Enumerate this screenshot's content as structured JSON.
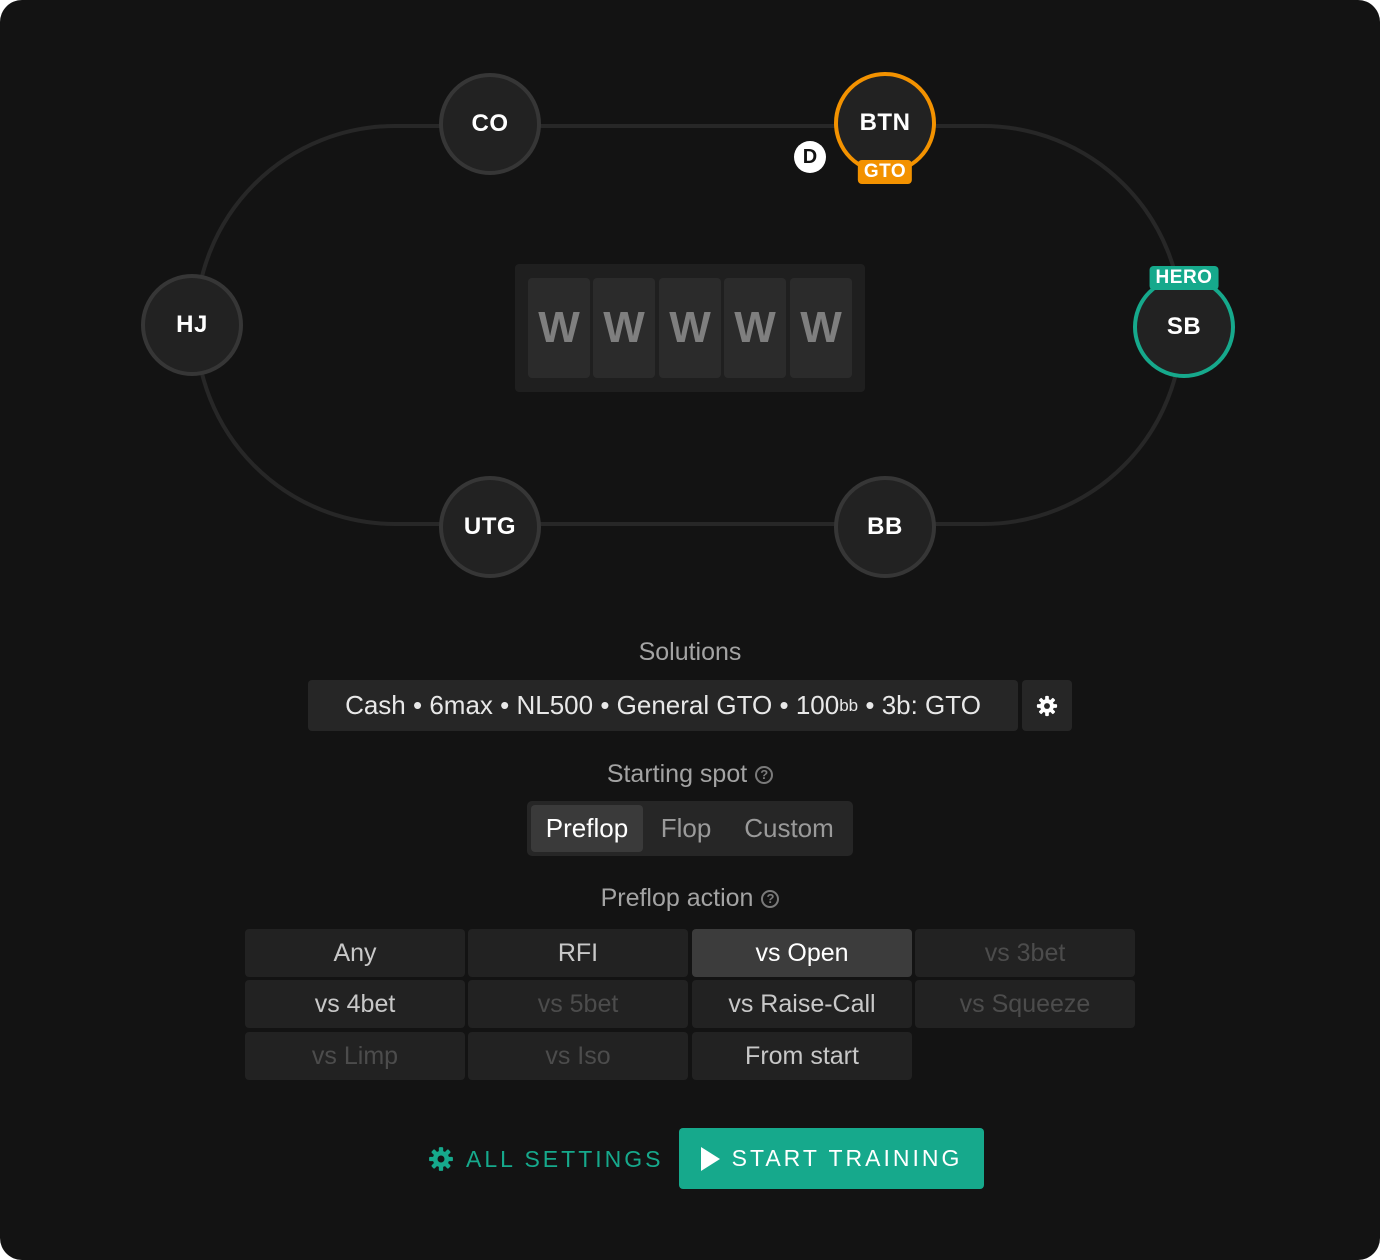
{
  "seats": [
    {
      "id": "co",
      "label": "CO"
    },
    {
      "id": "btn",
      "label": "BTN",
      "badge": "GTO"
    },
    {
      "id": "hj",
      "label": "HJ"
    },
    {
      "id": "sb",
      "label": "SB",
      "badge": "HERO"
    },
    {
      "id": "utg",
      "label": "UTG"
    },
    {
      "id": "bb",
      "label": "BB"
    }
  ],
  "dealer_label": "D",
  "board_card_mark": "W",
  "solutions": {
    "label": "Solutions",
    "parts": [
      "Cash",
      "6max",
      "NL500",
      "General GTO",
      "100",
      "bb",
      "3b: GTO"
    ],
    "separator": " • "
  },
  "starting_spot": {
    "label": "Starting spot",
    "options": [
      "Preflop",
      "Flop",
      "Custom"
    ],
    "selected": "Preflop"
  },
  "preflop_action": {
    "label": "Preflop action",
    "buttons": [
      {
        "label": "Any",
        "state": "normal"
      },
      {
        "label": "RFI",
        "state": "normal"
      },
      {
        "label": "vs Open",
        "state": "selected"
      },
      {
        "label": "vs 3bet",
        "state": "disabled"
      },
      {
        "label": "vs 4bet",
        "state": "normal"
      },
      {
        "label": "vs 5bet",
        "state": "disabled"
      },
      {
        "label": "vs Raise-Call",
        "state": "normal"
      },
      {
        "label": "vs Squeeze",
        "state": "disabled"
      },
      {
        "label": "vs Limp",
        "state": "disabled"
      },
      {
        "label": "vs Iso",
        "state": "disabled"
      },
      {
        "label": "From start",
        "state": "normal"
      }
    ]
  },
  "help_glyph": "?",
  "actions": {
    "all_settings": "ALL SETTINGS",
    "start_training": "START TRAINING"
  },
  "colors": {
    "accent": "#16a98c",
    "gto": "#f39200",
    "background": "#131313"
  }
}
